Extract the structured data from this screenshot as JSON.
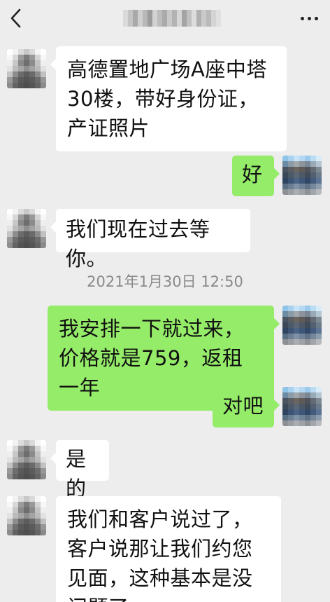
{
  "header": {
    "back_icon": "chevron-left-icon",
    "more_icon": "more-dots-icon",
    "title_obscured": true
  },
  "messages": [
    {
      "direction": "in",
      "text": "高德置地广场A座中塔30楼，带好身份证，产证照片"
    },
    {
      "direction": "out",
      "text": "好"
    },
    {
      "direction": "in",
      "text": "我们现在过去等你。"
    },
    {
      "type": "timestamp",
      "text": "2021年1月30日 12:50"
    },
    {
      "direction": "out",
      "text": "我安排一下就过来，价格就是759，返租一年"
    },
    {
      "direction": "out",
      "text": "对吧"
    },
    {
      "direction": "in",
      "text": "是的"
    },
    {
      "direction": "in",
      "text": "我们和客户说过了，客户说那让我们约您见面，这种基本是没问题了"
    }
  ],
  "colors": {
    "background": "#ededed",
    "incoming_bubble": "#ffffff",
    "outgoing_bubble": "#95ec69",
    "timestamp_text": "#8a8a8a"
  }
}
